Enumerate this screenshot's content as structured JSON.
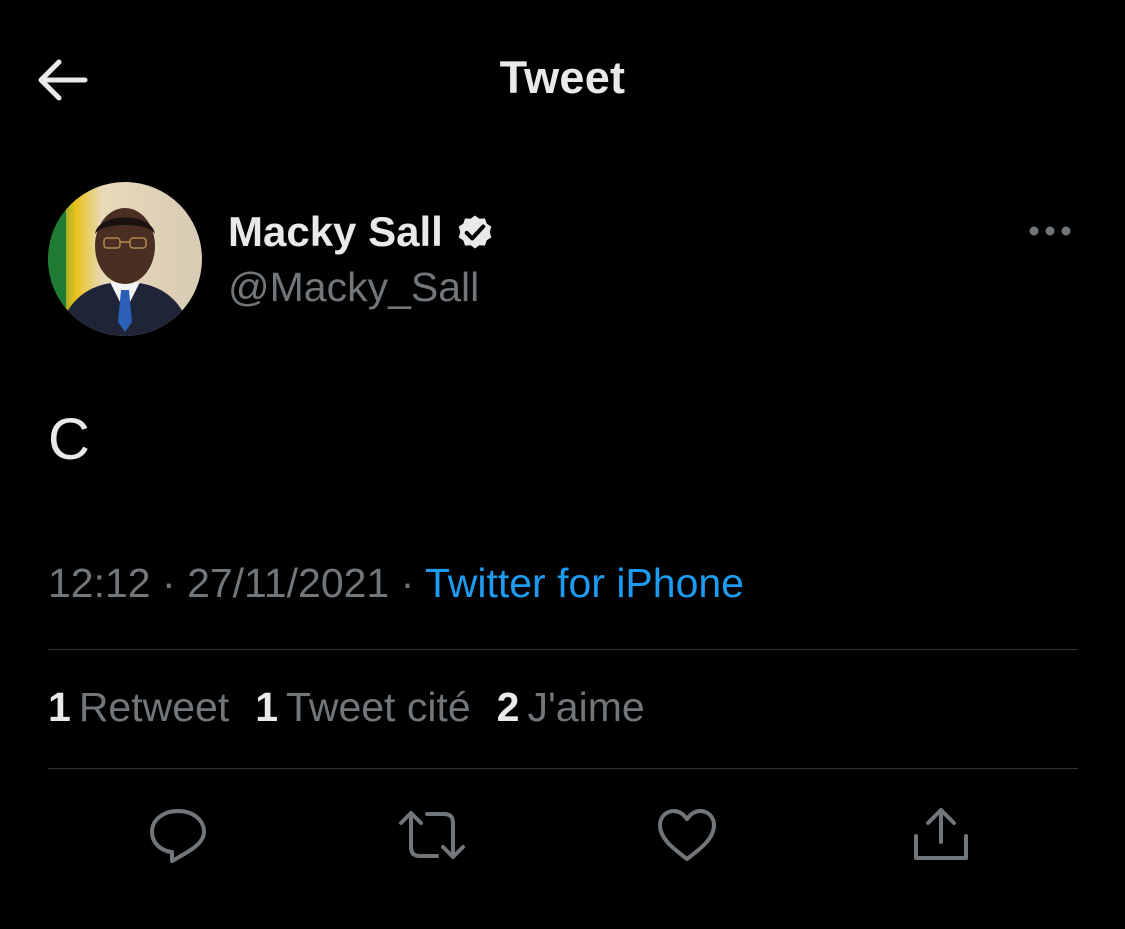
{
  "header": {
    "title": "Tweet",
    "back_icon": "arrow-left-icon"
  },
  "author": {
    "name": "Macky Sall",
    "handle": "@Macky_Sall",
    "verified": true,
    "verified_icon": "verified-badge-icon"
  },
  "tweet": {
    "text": "C",
    "time": "12:12",
    "date": "27/11/2021",
    "separator": "·",
    "source": "Twitter for iPhone"
  },
  "stats": [
    {
      "count": "1",
      "label": "Retweet"
    },
    {
      "count": "1",
      "label": "Tweet cité"
    },
    {
      "count": "2",
      "label": "J'aime"
    }
  ],
  "actions": [
    {
      "icon": "reply-icon"
    },
    {
      "icon": "retweet-icon"
    },
    {
      "icon": "like-icon"
    },
    {
      "icon": "share-icon"
    }
  ],
  "colors": {
    "background": "#000000",
    "text": "#e7e9ea",
    "secondary": "#71767b",
    "accent": "#1d9bf0",
    "divider": "#2f3336"
  }
}
